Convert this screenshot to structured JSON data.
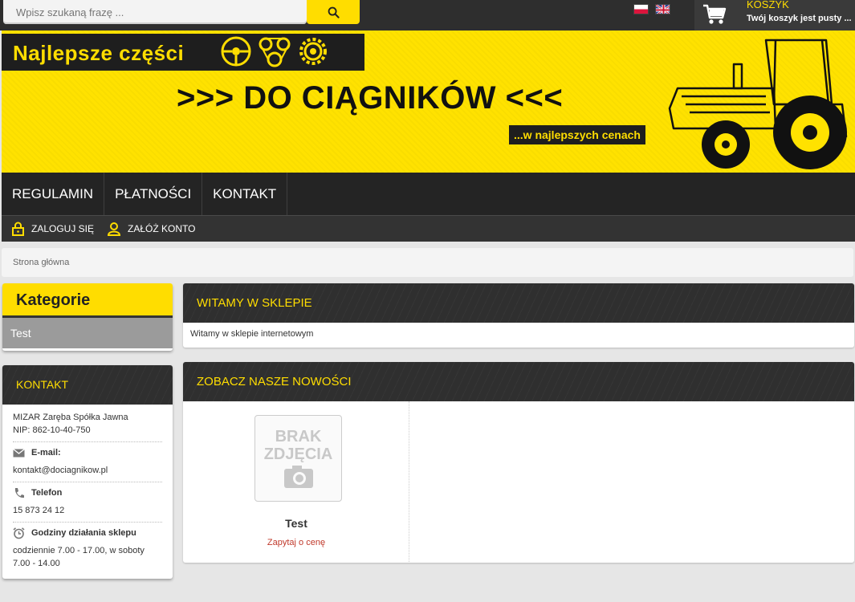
{
  "search": {
    "placeholder": "Wpisz szukaną frazę ..."
  },
  "languages": [
    "PL",
    "EN"
  ],
  "cart": {
    "title": "KOSZYK",
    "status": "Twój koszyk jest pusty ..."
  },
  "banner": {
    "tagline": "Najlepsze części",
    "headline": ">>> DO CIĄGNIKÓW <<<",
    "subline": "...w najlepszych cenach"
  },
  "nav": {
    "items": [
      "REGULAMIN",
      "PŁATNOŚCI",
      "KONTAKT"
    ]
  },
  "account": {
    "login": "ZALOGUJ SIĘ",
    "register": "ZAŁÓŻ KONTO"
  },
  "breadcrumb": "Strona główna",
  "categories": {
    "title": "Kategorie",
    "items": [
      "Test"
    ]
  },
  "contact": {
    "title": "KONTAKT",
    "company": "MIZAR Zaręba Spółka Jawna",
    "nip": "NIP: 862-10-40-750",
    "email_label": "E-mail:",
    "email": "kontakt@dociagnikow.pl",
    "phone_label": "Telefon",
    "phone": "15 873 24 12",
    "hours_label": "Godziny działania sklepu",
    "hours": "codziennie 7.00 - 17.00, w soboty 7.00 - 14.00"
  },
  "welcome": {
    "title": "WITAMY W SKLEPIE",
    "text": "Witamy w sklepie internetowym"
  },
  "news": {
    "title": "ZOBACZ NASZE NOWOŚCI",
    "products": [
      {
        "image_text": "BRAK ZDJĘCIA",
        "name": "Test",
        "price_link": "Zapytaj o cenę"
      }
    ]
  },
  "colors": {
    "accent": "#ffdd00",
    "dark": "#2e2e2e",
    "price_link": "#c0392b"
  }
}
